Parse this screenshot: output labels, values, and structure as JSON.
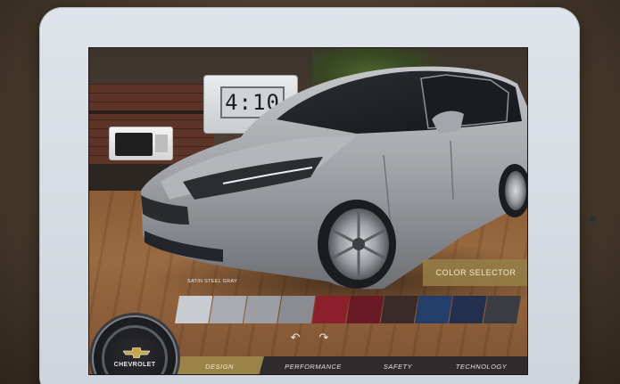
{
  "scene": {
    "clock_display": "4:10"
  },
  "configurator": {
    "color_selector_label": "COLOR SELECTOR",
    "selected_color_name": "SATIN STEEL GRAY",
    "swatches": [
      {
        "name": "swatch-1",
        "color": "#c9ccd1"
      },
      {
        "name": "swatch-2",
        "color": "#a9abb0"
      },
      {
        "name": "swatch-3",
        "color": "#9c9ea3"
      },
      {
        "name": "swatch-4",
        "color": "#8a8c91"
      },
      {
        "name": "swatch-5",
        "color": "#8b1f2b"
      },
      {
        "name": "swatch-6",
        "color": "#6a1a24"
      },
      {
        "name": "swatch-7",
        "color": "#3a2a28"
      },
      {
        "name": "swatch-8",
        "color": "#253d6b"
      },
      {
        "name": "swatch-9",
        "color": "#22304e"
      },
      {
        "name": "swatch-10",
        "color": "#3a3c41"
      }
    ],
    "rotate_left_icon": "rotate-left-icon",
    "rotate_right_icon": "rotate-right-icon"
  },
  "nav": {
    "tabs": [
      {
        "label": "DESIGN",
        "active": true
      },
      {
        "label": "PERFORMANCE",
        "active": false
      },
      {
        "label": "SAFETY",
        "active": false
      },
      {
        "label": "TECHNOLOGY",
        "active": false
      }
    ]
  },
  "brand": {
    "name": "CHEVROLET",
    "logo_icon": "chevrolet-bowtie-icon",
    "accent_color": "#a0884a"
  }
}
